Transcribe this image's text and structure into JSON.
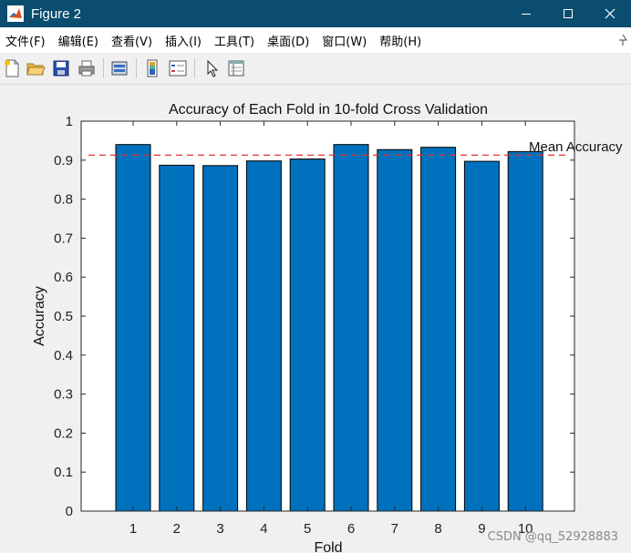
{
  "window": {
    "title": "Figure 2"
  },
  "menu": {
    "items": [
      "文件(F)",
      "编辑(E)",
      "查看(V)",
      "插入(I)",
      "工具(T)",
      "桌面(D)",
      "窗口(W)",
      "帮助(H)"
    ]
  },
  "toolbar": {
    "buttons": [
      "new-figure-icon",
      "open-folder-icon",
      "save-icon",
      "print-icon",
      "link-plot-icon",
      "insert-colorbar-icon",
      "insert-legend-icon",
      "pointer-icon",
      "property-inspector-icon"
    ]
  },
  "chart_data": {
    "type": "bar",
    "title": "Accuracy of Each Fold in 10-fold Cross Validation",
    "xlabel": "Fold",
    "ylabel": "Accuracy",
    "categories": [
      "1",
      "2",
      "3",
      "4",
      "5",
      "6",
      "7",
      "8",
      "9",
      "10"
    ],
    "values": [
      0.94,
      0.887,
      0.886,
      0.898,
      0.903,
      0.94,
      0.927,
      0.933,
      0.897,
      0.922
    ],
    "ylim": [
      0,
      1
    ],
    "yticks": [
      "0",
      "0.1",
      "0.2",
      "0.3",
      "0.4",
      "0.5",
      "0.6",
      "0.7",
      "0.8",
      "0.9",
      "1"
    ],
    "bar_color": "#0072bd",
    "mean_line": {
      "value": 0.913,
      "label": "Mean Accuracy",
      "color": "#e03030",
      "style": "dashed"
    },
    "grid": false
  },
  "watermark": "CSDN @qq_52928883"
}
